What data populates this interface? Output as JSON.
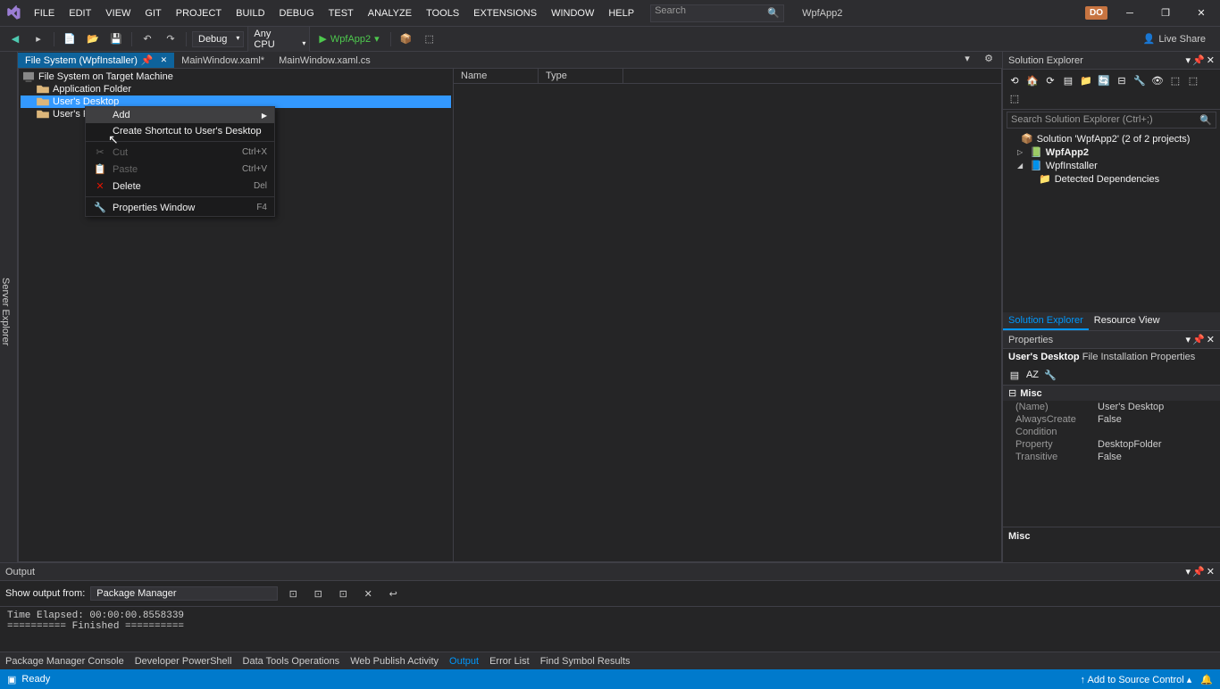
{
  "menubar": [
    "FILE",
    "EDIT",
    "VIEW",
    "GIT",
    "PROJECT",
    "BUILD",
    "DEBUG",
    "TEST",
    "ANALYZE",
    "TOOLS",
    "EXTENSIONS",
    "WINDOW",
    "HELP"
  ],
  "search_placeholder": "Search",
  "app_name": "WpfApp2",
  "user_initials": "DO",
  "toolbar": {
    "config": "Debug",
    "platform": "Any CPU",
    "start_target": "WpfApp2"
  },
  "live_share": "Live Share",
  "tabs": [
    {
      "label": "File System (WpfInstaller)",
      "active": true
    },
    {
      "label": "MainWindow.xaml*",
      "active": false
    },
    {
      "label": "MainWindow.xaml.cs",
      "active": false
    }
  ],
  "fs_tree": {
    "root": "File System on Target Machine",
    "items": [
      "Application Folder",
      "User's Desktop",
      "User's Pro"
    ]
  },
  "detail_cols": [
    "Name",
    "Type"
  ],
  "context_menu": [
    {
      "label": "Add",
      "arrow": true,
      "hover": true
    },
    {
      "label": "Create Shortcut to User's Desktop"
    },
    {
      "label": "Cut",
      "shortcut": "Ctrl+X",
      "disabled": true,
      "icon": "cut"
    },
    {
      "label": "Paste",
      "shortcut": "Ctrl+V",
      "disabled": true,
      "icon": "paste"
    },
    {
      "label": "Delete",
      "shortcut": "Del",
      "icon": "delete"
    },
    {
      "label": "Properties Window",
      "shortcut": "F4",
      "icon": "wrench"
    }
  ],
  "sln": {
    "title": "Solution Explorer",
    "search_placeholder": "Search Solution Explorer (Ctrl+;)",
    "root": "Solution 'WpfApp2' (2 of 2 projects)",
    "proj1": "WpfApp2",
    "proj2": "WpfInstaller",
    "dep": "Detected Dependencies",
    "tabs": [
      "Solution Explorer",
      "Resource View"
    ]
  },
  "props": {
    "title": "Properties",
    "subject_name": "User's Desktop",
    "subject_type": "File Installation Properties",
    "category": "Misc",
    "rows": [
      {
        "name": "(Name)",
        "val": "User's Desktop"
      },
      {
        "name": "AlwaysCreate",
        "val": "False"
      },
      {
        "name": "Condition",
        "val": ""
      },
      {
        "name": "Property",
        "val": "DesktopFolder"
      },
      {
        "name": "Transitive",
        "val": "False"
      }
    ],
    "desc_title": "Misc"
  },
  "output": {
    "title": "Output",
    "from_label": "Show output from:",
    "from_value": "Package Manager",
    "text": "Time Elapsed: 00:00:00.8558339\n========== Finished =========="
  },
  "bottom_tabs": [
    "Package Manager Console",
    "Developer PowerShell",
    "Data Tools Operations",
    "Web Publish Activity",
    "Output",
    "Error List",
    "Find Symbol Results"
  ],
  "status": {
    "left": "Ready",
    "source_control": "Add to Source Control"
  }
}
